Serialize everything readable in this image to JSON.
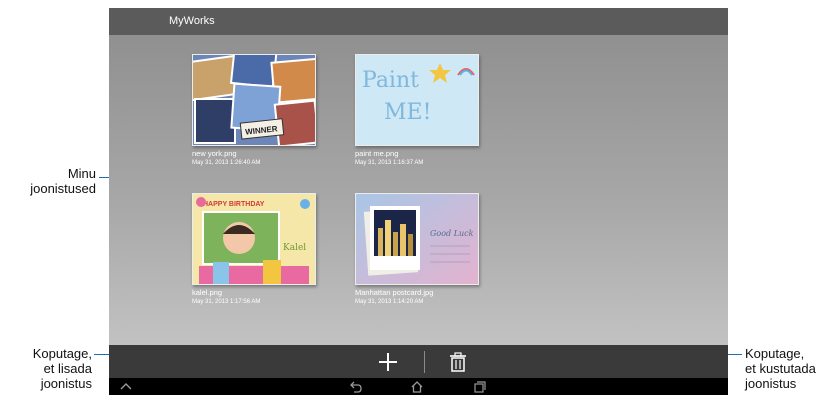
{
  "app": {
    "title": "MyWorks"
  },
  "works": [
    {
      "name": "new york.png",
      "date": "May 31, 2013 1:26:40 AM"
    },
    {
      "name": "paint me.png",
      "date": "May 31, 2013 1:16:37 AM"
    },
    {
      "name": "kalel.png",
      "date": "May 31, 2013 1:17:56 AM"
    },
    {
      "name": "Manhattan postcard.jpg",
      "date": "May 31, 2013 1:14:20 AM"
    }
  ],
  "thumb_text": {
    "paint_line1": "Paint",
    "paint_line2": "ME!",
    "winner": "WINNER",
    "birthday": "HAPPY BIRTHDAY",
    "kalel": "Kalel",
    "good_luck": "Good Luck"
  },
  "callouts": {
    "my_drawings_line1": "Minu",
    "my_drawings_line2": "joonistused",
    "add_line1": "Koputage,",
    "add_line2": "et lisada",
    "add_line3": "joonistus",
    "delete_line1": "Koputage,",
    "delete_line2": "et kustutada",
    "delete_line3": "joonistus"
  },
  "icons": {
    "add": "plus-icon",
    "delete": "trash-icon",
    "nav": [
      "up-chevron-icon",
      "back-icon",
      "home-icon",
      "recent-apps-icon"
    ]
  },
  "colors": {
    "title_bar": "#5b5b5b",
    "action_bar": "#3a3a3a",
    "nav_bar": "#000000",
    "callout_line": "#1a6fb5"
  }
}
